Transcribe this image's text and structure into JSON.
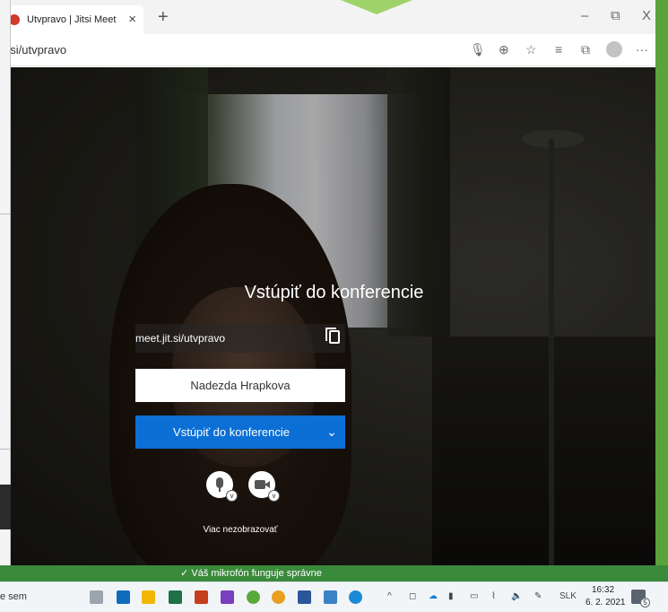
{
  "browser": {
    "tab_title": "Utvpravo | Jitsi Meet",
    "tab_close": "×",
    "new_tab": "+",
    "url": ":.si/utvpravo",
    "window_controls": {
      "minimize": "–",
      "restore": "⧉",
      "close": "X"
    },
    "toolbar_icons": [
      "microphone-icon",
      "add-icon",
      "favorite-icon",
      "favorites-list-icon",
      "collections-icon",
      "profile-icon",
      "more-icon"
    ],
    "more_label": "···"
  },
  "prejoin": {
    "title": "Vstúpiť do konferencie",
    "meeting_url": "meet.jit.si/utvpravo",
    "name_value": "Nadezda Hrapkova",
    "join_label": "Vstúpiť do konferencie",
    "dont_show_label": "Viac nezobrazovať"
  },
  "status": {
    "message": "✓ Váš mikrofón funguje správne"
  },
  "taskbar": {
    "search_text": "e sem",
    "language": "SLK",
    "time": "16:32",
    "date": "6. 2. 2021",
    "notification_count": "5"
  }
}
